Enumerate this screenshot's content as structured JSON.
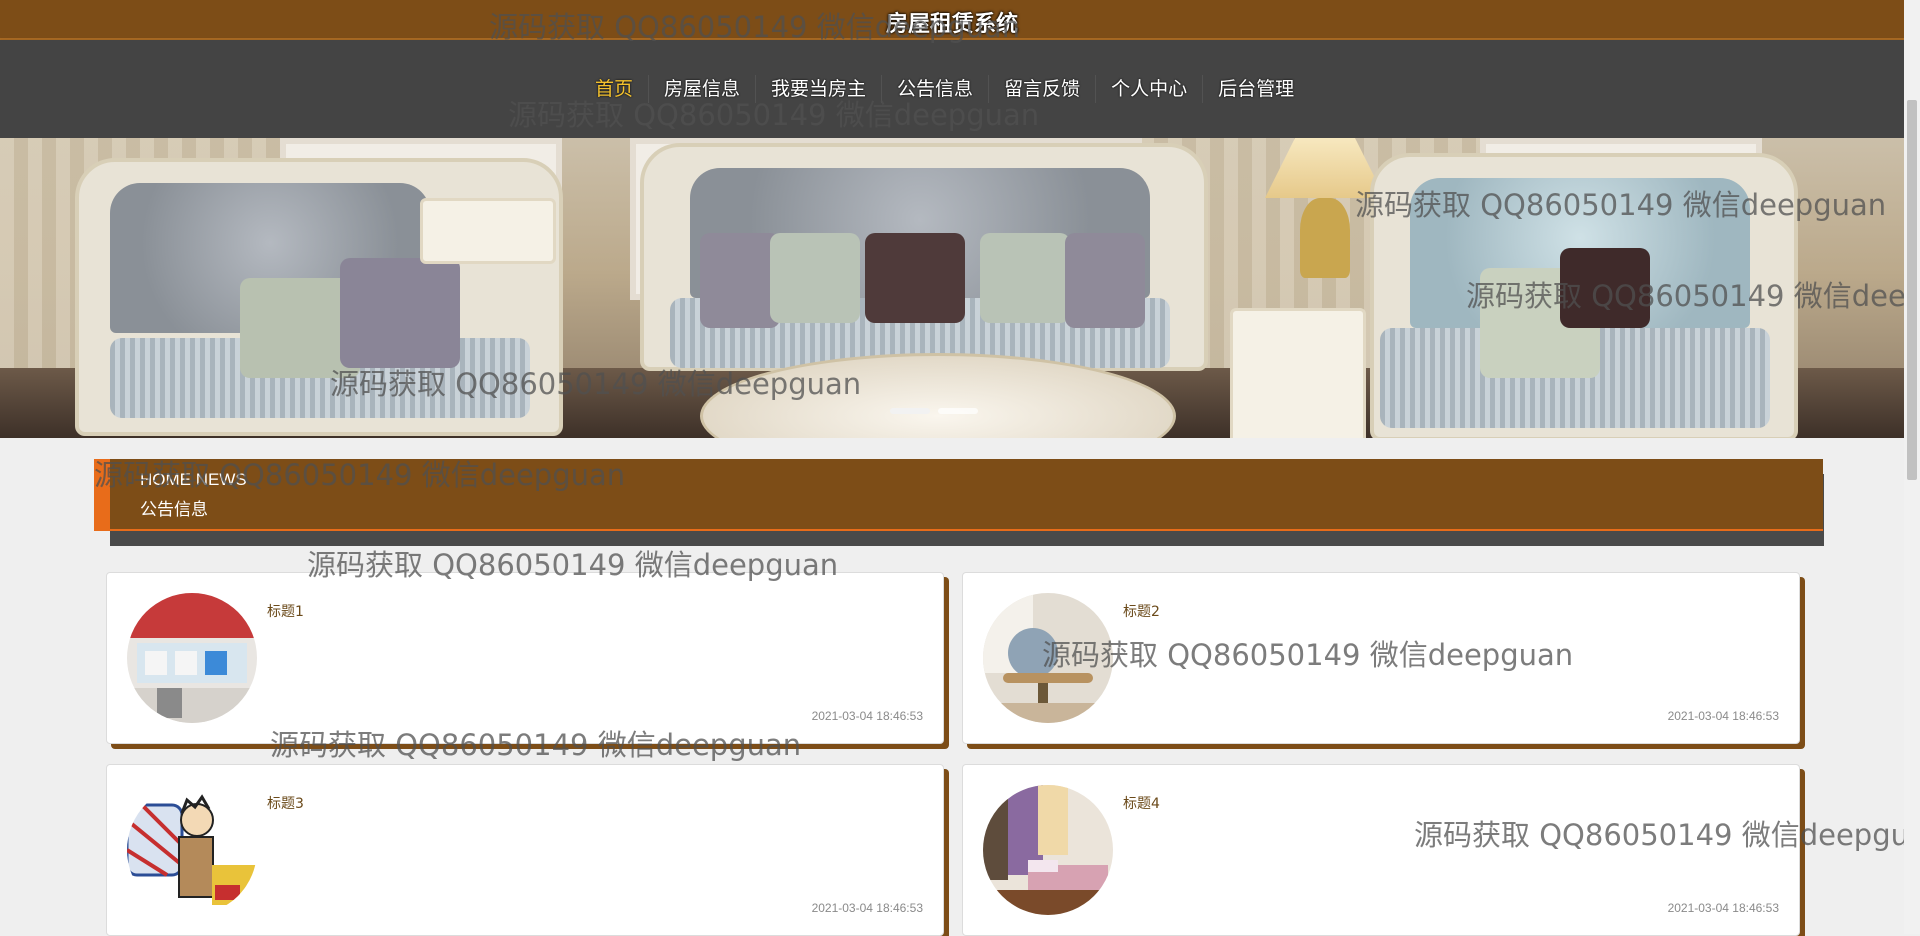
{
  "site": {
    "title": "房屋租赁系统"
  },
  "nav": {
    "items": [
      {
        "label": "首页",
        "active": true
      },
      {
        "label": "房屋信息",
        "active": false
      },
      {
        "label": "我要当房主",
        "active": false
      },
      {
        "label": "公告信息",
        "active": false
      },
      {
        "label": "留言反馈",
        "active": false
      },
      {
        "label": "个人中心",
        "active": false
      },
      {
        "label": "后台管理",
        "active": false
      }
    ]
  },
  "news_section": {
    "title_en": "HOME NEWS",
    "title_cn": "公告信息"
  },
  "news": [
    {
      "title": "标题1",
      "time": "2021-03-04 18:46:53",
      "thumb": "shop-interior-icon"
    },
    {
      "title": "标题2",
      "time": "2021-03-04 18:46:53",
      "thumb": "living-room-icon"
    },
    {
      "title": "标题3",
      "time": "2021-03-04 18:46:53",
      "thumb": "cartoon-tenant-icon"
    },
    {
      "title": "标题4",
      "time": "2021-03-04 18:46:53",
      "thumb": "bedroom-icon"
    }
  ],
  "watermark": "源码获取 QQ86050149 微信deepguan",
  "colors": {
    "brand": "#7d4d17",
    "nav_bg": "#444444",
    "active": "#f3c12d",
    "accent": "#e86c1a"
  }
}
